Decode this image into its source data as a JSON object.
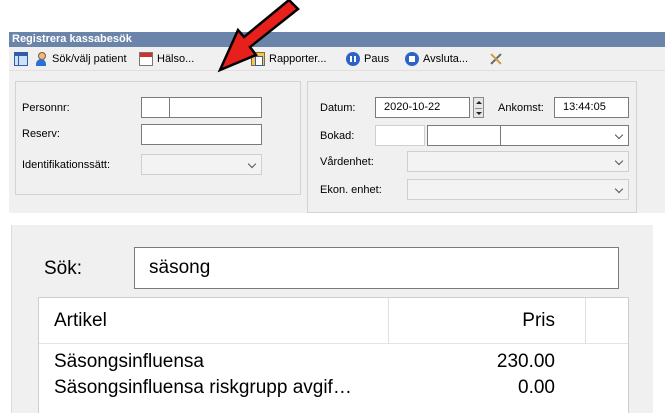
{
  "window": {
    "title": "Registrera kassabesök"
  },
  "toolbar": {
    "search_patient": "Sök/välj patient",
    "health": "Hälso...",
    "reports": "Rapporter...",
    "pause": "Paus",
    "quit": "Avsluta..."
  },
  "form_left": {
    "personnr_label": "Personnr:",
    "reserv_label": "Reserv:",
    "ident_label": "Identifikationssätt:"
  },
  "form_right": {
    "datum_label": "Datum:",
    "datum_value": "2020-10-22",
    "ankomst_label": "Ankomst:",
    "ankomst_value": "13:44:05",
    "bokad_label": "Bokad:",
    "vardenhet_label": "Vårdenhet:",
    "ekon_label": "Ekon. enhet:"
  },
  "search": {
    "label": "Sök:",
    "value": "säsong"
  },
  "results": {
    "columns": [
      "Artikel",
      "Pris"
    ],
    "rows": [
      {
        "artikel": "Säsongsinfluensa",
        "pris": "230.00"
      },
      {
        "artikel": "Säsongsinfluensa riskgrupp avgif…",
        "pris": "0.00"
      }
    ]
  },
  "colors": {
    "titlebar": "#6b84a9",
    "annotation_arrow": "#e8201b",
    "form_bg": "#f0f0f0"
  },
  "icons": [
    "window-icon",
    "person-icon",
    "calendar-icon",
    "report-icon",
    "pause-icon",
    "stop-icon",
    "tools-icon"
  ]
}
